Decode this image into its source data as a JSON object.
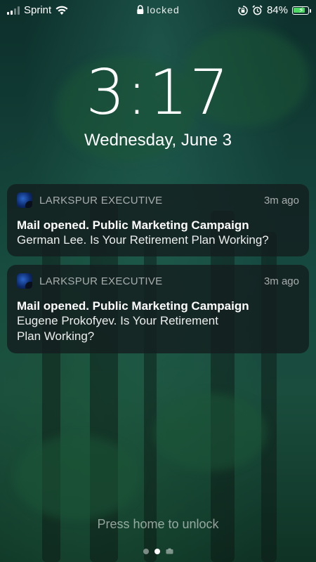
{
  "status_bar": {
    "carrier": "Sprint",
    "lock_text": "locked",
    "battery_percent": "84%",
    "battery_level": 0.84,
    "icons": [
      "signal-icon",
      "wifi-icon",
      "lock-icon",
      "rotation-lock-icon",
      "alarm-icon",
      "battery-charging-icon"
    ]
  },
  "lock_screen": {
    "time": "3:17",
    "date": "Wednesday, June 3",
    "unlock_hint": "Press home to unlock"
  },
  "notifications": [
    {
      "app": "LARKSPUR EXECUTIVE",
      "time_ago": "3m ago",
      "title": "Mail opened. Public Marketing Campaign",
      "body": "German Lee. Is Your Retirement Plan Working?"
    },
    {
      "app": "LARKSPUR EXECUTIVE",
      "time_ago": "3m ago",
      "title": "Mail opened. Public Marketing Campaign",
      "body": "Eugene Prokofyev. Is Your Retirement Plan Working?"
    }
  ],
  "pager": {
    "total": 3,
    "active_index": 1
  }
}
